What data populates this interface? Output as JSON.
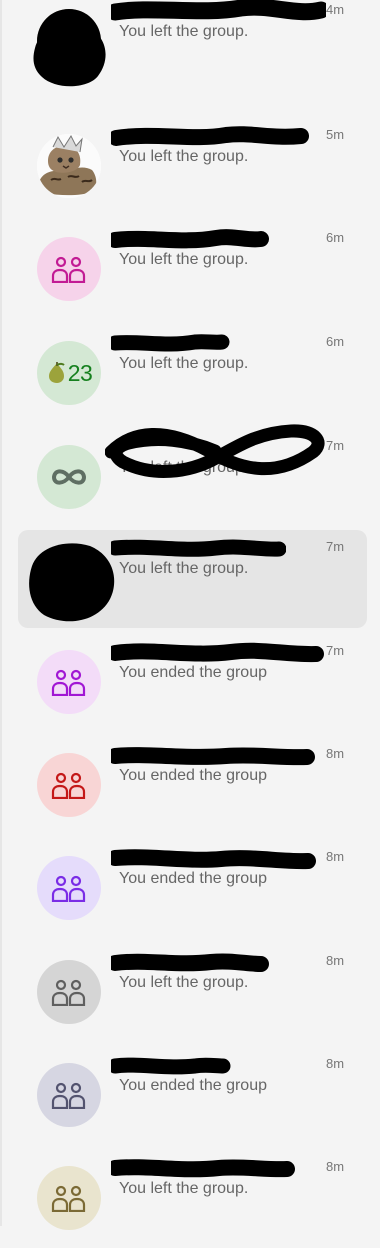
{
  "conversations": [
    {
      "name": "",
      "preview": "You left the group.",
      "time": "4m",
      "avatar": {
        "icon": "photo-redacted",
        "bg": "#d8c6b4"
      }
    },
    {
      "name": "",
      "preview": "You left the group.",
      "time": "5m",
      "avatar": {
        "icon": "cat-photo",
        "bg": "#ffffff"
      }
    },
    {
      "name": "",
      "preview": "You left the group.",
      "time": "6m",
      "avatar": {
        "icon": "group-icon",
        "bg": "#f6d3ea",
        "fg": "#c21b94"
      }
    },
    {
      "name": "",
      "preview": "You left the group.",
      "time": "6m",
      "avatar": {
        "icon": "pear-emoji",
        "text": "23",
        "bg": "#d4e8d4",
        "fg": "#16801f"
      }
    },
    {
      "name": "",
      "preview": "You left the group.",
      "time": "7m",
      "avatar": {
        "icon": "infinity-icon",
        "bg": "#d4e8d4",
        "fg": "#5f6f63"
      }
    },
    {
      "name": "",
      "preview": "You left the group.",
      "time": "7m",
      "avatar": {
        "icon": "photo-redacted",
        "bg": "#cfcfcf"
      }
    },
    {
      "name": "",
      "preview": "You ended the group",
      "time": "7m",
      "avatar": {
        "icon": "group-icon",
        "bg": "#f3dcf8",
        "fg": "#a117d4"
      }
    },
    {
      "name": "",
      "preview": "You ended the group",
      "time": "8m",
      "avatar": {
        "icon": "group-icon",
        "bg": "#f8d5d5",
        "fg": "#c41818"
      }
    },
    {
      "name": "",
      "preview": "You ended the group",
      "time": "8m",
      "avatar": {
        "icon": "group-icon",
        "bg": "#e5dcfb",
        "fg": "#7a2ce6"
      }
    },
    {
      "name": "",
      "preview": "You left the group.",
      "time": "8m",
      "avatar": {
        "icon": "group-icon",
        "bg": "#d5d5d5",
        "fg": "#5f5f5f"
      }
    },
    {
      "name": "",
      "preview": "You ended the group",
      "time": "8m",
      "avatar": {
        "icon": "group-icon",
        "bg": "#d6d6e2",
        "fg": "#53536f"
      }
    },
    {
      "name": "",
      "preview": "You left the group.",
      "time": "8m",
      "avatar": {
        "icon": "group-icon",
        "bg": "#e9e4ce",
        "fg": "#7b6a35"
      }
    }
  ]
}
